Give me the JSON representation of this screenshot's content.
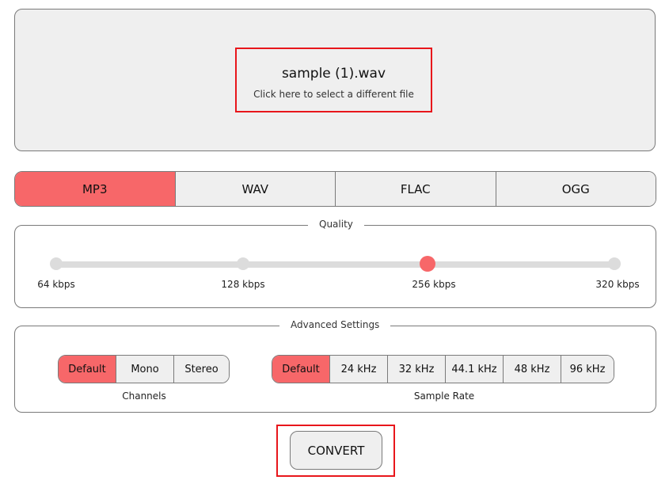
{
  "file": {
    "name": "sample (1).wav",
    "hint": "Click here to select a different file"
  },
  "formats": [
    {
      "label": "MP3",
      "active": true
    },
    {
      "label": "WAV",
      "active": false
    },
    {
      "label": "FLAC",
      "active": false
    },
    {
      "label": "OGG",
      "active": false
    }
  ],
  "quality": {
    "legend": "Quality",
    "options": [
      "64 kbps",
      "128 kbps",
      "256 kbps",
      "320 kbps"
    ],
    "selected": "256 kbps"
  },
  "advanced": {
    "legend": "Advanced Settings",
    "channels": {
      "label": "Channels",
      "options": [
        "Default",
        "Mono",
        "Stereo"
      ],
      "selected": "Default"
    },
    "sample_rate": {
      "label": "Sample Rate",
      "options": [
        "Default",
        "24 kHz",
        "32 kHz",
        "44.1 kHz",
        "48 kHz",
        "96 kHz"
      ],
      "selected": "Default"
    }
  },
  "convert": {
    "label": "CONVERT"
  },
  "colors": {
    "accent": "#f76769",
    "highlight": "#e8161b",
    "panel_bg": "#efefef"
  }
}
